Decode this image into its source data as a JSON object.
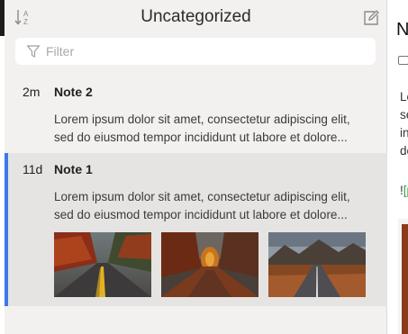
{
  "header": {
    "title": "Uncategorized",
    "sort_icon": "sort-az-icon",
    "compose_icon": "compose-icon"
  },
  "filter": {
    "placeholder": "Filter",
    "value": "",
    "icon": "filter-icon"
  },
  "notes": [
    {
      "age": "2m",
      "title": "Note 2",
      "excerpt": [
        "Lorem ipsum dolor sit amet, consectetur adipiscing elit,",
        "sed do eiusmod tempor incididunt ut labore et dolore..."
      ],
      "selected": false
    },
    {
      "age": "11d",
      "title": "Note 1",
      "excerpt": [
        "Lorem ipsum dolor sit amet, consectetur adipiscing elit,",
        "sed do eiusmod tempor incididunt ut labore et dolore..."
      ],
      "selected": true,
      "thumbnails": [
        "autumn-road-thumbnail",
        "autumn-forest-path-thumbnail",
        "mountain-road-thumbnail"
      ]
    }
  ],
  "detail": {
    "title": "N",
    "body": [
      "Lo",
      "se",
      "in",
      "de"
    ],
    "link_prefix": "!",
    "link_text": "[p"
  },
  "colors": {
    "accent": "#3b79e8",
    "list_bg": "#f2f1ef",
    "selected_bg": "#e5e4e2",
    "link": "#2a9d3a"
  }
}
